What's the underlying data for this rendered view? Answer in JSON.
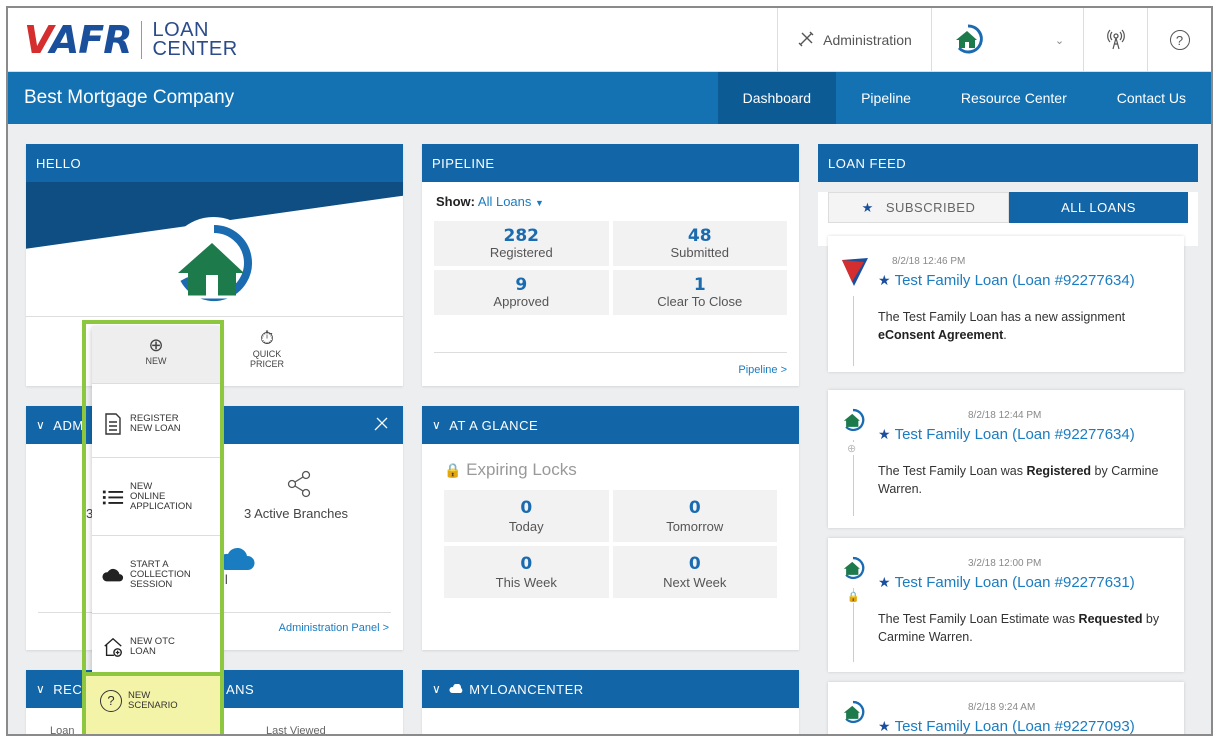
{
  "header": {
    "logo_brand": "AFR",
    "logo_sub_1": "LOAN",
    "logo_sub_2": "CENTER",
    "admin_label": "Administration",
    "user_name": ""
  },
  "nav": {
    "company": "Best Mortgage Company",
    "links": [
      "Dashboard",
      "Pipeline",
      "Resource Center",
      "Contact Us"
    ],
    "active": "Dashboard"
  },
  "hello": {
    "title": "HELLO",
    "actions": [
      {
        "label_1": "NEW",
        "label_2": ""
      },
      {
        "label_1": "QUICK",
        "label_2": "PRICER"
      }
    ]
  },
  "new_menu": {
    "items": [
      {
        "line1": "REGISTER",
        "line2": "NEW LOAN",
        "line3": ""
      },
      {
        "line1": "NEW",
        "line2": "ONLINE",
        "line3": "APPLICATION"
      },
      {
        "line1": "START A",
        "line2": "COLLECTION",
        "line3": "SESSION"
      },
      {
        "line1": "NEW OTC",
        "line2": "LOAN",
        "line3": ""
      },
      {
        "line1": "NEW",
        "line2": "SCENARIO",
        "line3": ""
      }
    ]
  },
  "admin": {
    "title_visible": "ADM",
    "branches": "3 Active Branches",
    "partial_left": "3",
    "partial_ll": "ll",
    "panel_link": "Administration Panel >"
  },
  "recent": {
    "title_left": "REC",
    "title_right": "ANS",
    "col1": "Loan",
    "col2": "Last Viewed"
  },
  "pipeline": {
    "title": "PIPELINE",
    "show_label": "Show:",
    "show_value": "All Loans",
    "stats": [
      {
        "num": "282",
        "label": "Registered"
      },
      {
        "num": "48",
        "label": "Submitted"
      },
      {
        "num": "9",
        "label": "Approved"
      },
      {
        "num": "1",
        "label": "Clear To Close"
      }
    ],
    "link": "Pipeline >"
  },
  "glance": {
    "title": "AT A GLANCE",
    "subtitle": "Expiring Locks",
    "stats": [
      {
        "num": "0",
        "label": "Today"
      },
      {
        "num": "0",
        "label": "Tomorrow"
      },
      {
        "num": "0",
        "label": "This Week"
      },
      {
        "num": "0",
        "label": "Next Week"
      }
    ]
  },
  "myloancenter": {
    "title": "MYLOANCENTER"
  },
  "feed": {
    "title": "LOAN FEED",
    "tab_subscribed": "SUBSCRIBED",
    "tab_all": "ALL LOANS",
    "cards": [
      {
        "time": "8/2/18 12:46 PM",
        "title": "Test Family Loan (Loan #92277634)",
        "pre": "The Test Family Loan has a new assignment ",
        "bold": "eConsent Agreement",
        "post": "."
      },
      {
        "time": "8/2/18 12:44 PM",
        "title": "Test Family Loan (Loan #92277634)",
        "pre": "The Test Family Loan was ",
        "bold": "Registered",
        "post": " by Carmine Warren."
      },
      {
        "time": "3/2/18 12:00 PM",
        "title": "Test Family Loan (Loan #92277631)",
        "pre": "The Test Family Loan Estimate was ",
        "bold": "Requested",
        "post": " by Carmine Warren."
      },
      {
        "time": "8/2/18 9:24 AM",
        "title": "Test Family Loan (Loan #92277093)",
        "pre": "",
        "bold": "",
        "post": ""
      }
    ]
  },
  "colors": {
    "nav_blue": "#1472b3",
    "panel_head": "#1266a8",
    "highlight": "#8dc63f",
    "scenario_bg": "#f4f4a8"
  }
}
